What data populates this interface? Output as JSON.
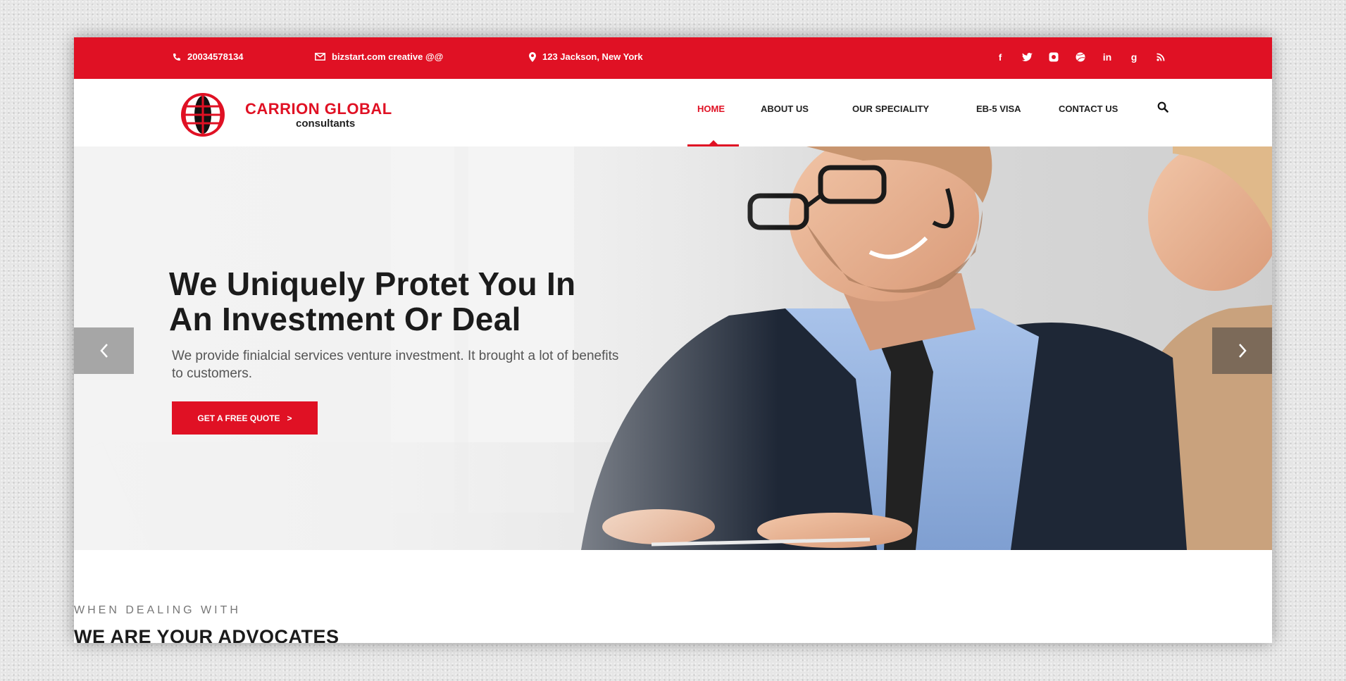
{
  "topbar": {
    "phone": "20034578134",
    "email": "bizstart.com creative @@",
    "address": "123 Jackson, New York",
    "socials": [
      "facebook-icon",
      "twitter-icon",
      "instagram-icon",
      "dribbble-icon",
      "linkedin-icon",
      "google-plus-icon",
      "rss-icon"
    ],
    "accent": "#e01124"
  },
  "logo": {
    "title": "CARRION GLOBAL",
    "subtitle": "consultants"
  },
  "nav": {
    "items": [
      {
        "label": "HOME",
        "active": true
      },
      {
        "label": "ABOUT US"
      },
      {
        "label": "OUR SPECIALITY"
      },
      {
        "label": "EB-5 VISA"
      },
      {
        "label": "CONTACT US"
      }
    ]
  },
  "hero": {
    "title_line1": "We Uniquely Protet You In",
    "title_line2": "An Investment Or Deal",
    "subtitle": "We provide finialcial services venture investment. It brought a lot of benefits to customers.",
    "cta": "GET A FREE QUOTE",
    "cta_arrow": ">"
  },
  "section": {
    "eyebrow": "WHEN DEALING WITH",
    "title": "WE ARE YOUR ADVOCATES"
  }
}
